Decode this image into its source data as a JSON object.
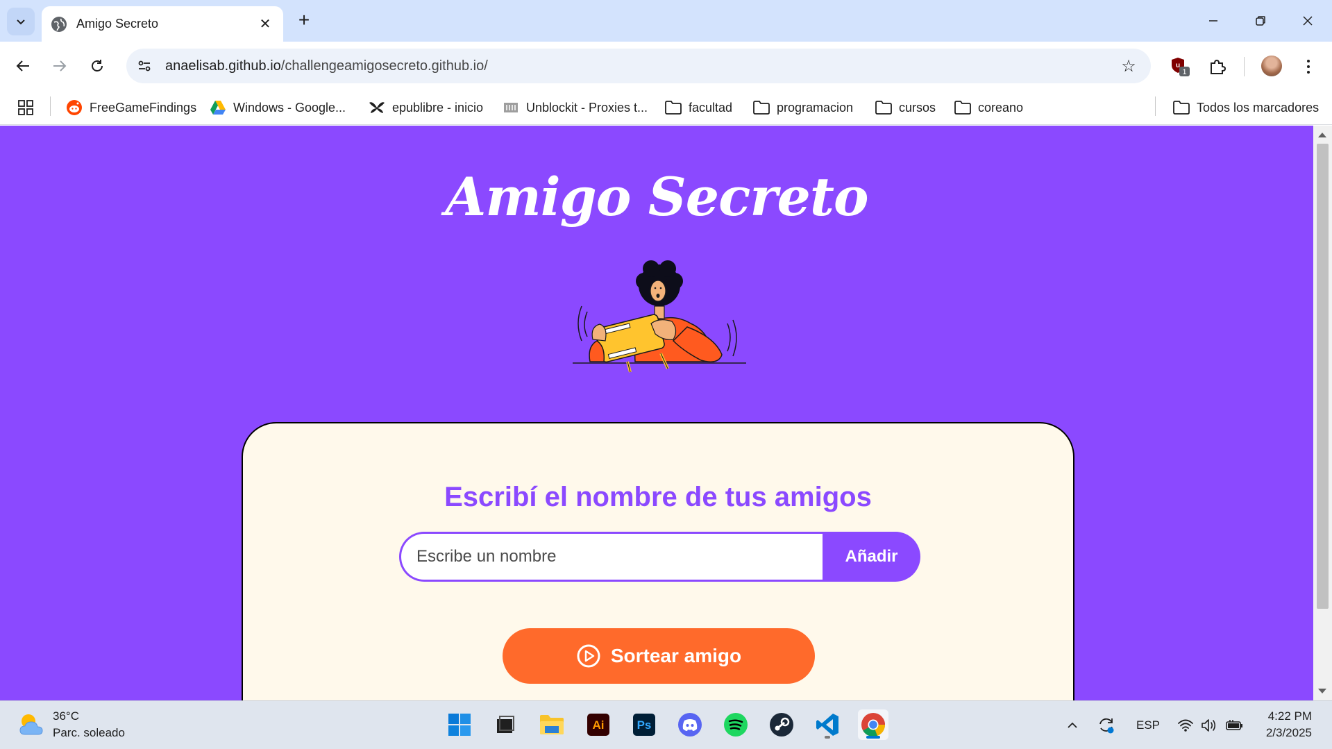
{
  "browser": {
    "tab_title": "Amigo Secreto",
    "url_host": "anaelisab.github.io",
    "url_path": "/challengeamigosecreto.github.io/",
    "extension_badge": "1"
  },
  "bookmarks": {
    "items": [
      {
        "label": "FreeGameFindings",
        "icon": "reddit-icon"
      },
      {
        "label": "Windows - Google...",
        "icon": "google-drive-icon"
      },
      {
        "label": "epublibre - inicio",
        "icon": "epublibre-icon"
      },
      {
        "label": "Unblockit - Proxies t...",
        "icon": "unblockit-icon"
      },
      {
        "label": "facultad",
        "icon": "folder-icon"
      },
      {
        "label": "programacion",
        "icon": "folder-icon"
      },
      {
        "label": "cursos",
        "icon": "folder-icon"
      },
      {
        "label": "coreano",
        "icon": "folder-icon"
      }
    ],
    "all_bookmarks": "Todos los marcadores"
  },
  "page": {
    "title": "Amigo Secreto",
    "heading": "Escribí el nombre de tus amigos",
    "input_placeholder": "Escribe un nombre",
    "add_button": "Añadir",
    "draw_button": "Sortear amigo",
    "colors": {
      "background": "#8b49ff",
      "card": "#fff9eb",
      "accent": "#8b49ff",
      "draw_button": "#ff6a2b"
    }
  },
  "taskbar": {
    "weather_temp": "36°C",
    "weather_desc": "Parc. soleado",
    "apps": [
      "windows-start-icon",
      "file-explorer-dark-icon",
      "folder-app-icon",
      "illustrator-icon",
      "photoshop-icon",
      "discord-icon",
      "spotify-icon",
      "steam-icon",
      "vscode-icon",
      "chrome-icon"
    ],
    "illustrator_label": "Ai",
    "photoshop_label": "Ps",
    "language": "ESP",
    "time": "4:22 PM",
    "date": "2/3/2025"
  }
}
